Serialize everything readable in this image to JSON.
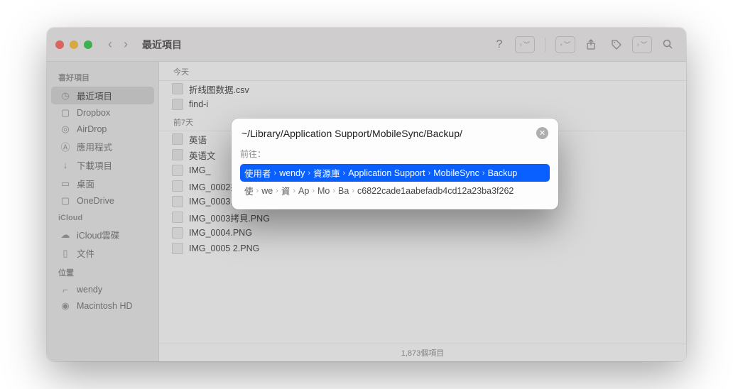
{
  "window": {
    "title": "最近項目"
  },
  "sidebar": {
    "sections": [
      {
        "header": "喜好項目",
        "items": [
          {
            "icon": "clock",
            "label": "最近項目",
            "active": true
          },
          {
            "icon": "folder",
            "label": "Dropbox"
          },
          {
            "icon": "airdrop",
            "label": "AirDrop"
          },
          {
            "icon": "apps",
            "label": "應用程式"
          },
          {
            "icon": "download",
            "label": "下載項目"
          },
          {
            "icon": "desktop",
            "label": "桌面"
          },
          {
            "icon": "folder",
            "label": "OneDrive"
          }
        ]
      },
      {
        "header": "iCloud",
        "items": [
          {
            "icon": "cloud",
            "label": "iCloud雲碟"
          },
          {
            "icon": "doc",
            "label": "文件"
          }
        ]
      },
      {
        "header": "位置",
        "items": [
          {
            "icon": "laptop",
            "label": "wendy"
          },
          {
            "icon": "disk",
            "label": "Macintosh HD"
          }
        ]
      }
    ]
  },
  "content": {
    "groups": [
      {
        "header": "今天",
        "files": [
          {
            "kind": "doc",
            "name": "折线图数据.csv"
          },
          {
            "kind": "exec",
            "name": "find-i"
          }
        ]
      },
      {
        "header": "前7天",
        "files": [
          {
            "kind": "doc",
            "name": "英语"
          },
          {
            "kind": "doc",
            "name": "英语文"
          },
          {
            "kind": "png",
            "name": "IMG_"
          },
          {
            "kind": "png",
            "name": "IMG_0002拷貝.PNG"
          },
          {
            "kind": "png",
            "name": "IMG_0003.PNG"
          },
          {
            "kind": "png",
            "name": "IMG_0003拷貝.PNG"
          },
          {
            "kind": "png",
            "name": "IMG_0004.PNG"
          },
          {
            "kind": "png",
            "name": "IMG_0005 2.PNG"
          }
        ]
      }
    ],
    "footer": "1,873個項目"
  },
  "goto": {
    "path": "~/Library/Application Support/MobileSync/Backup/",
    "label": "前往：",
    "primary": [
      "使用者",
      "wendy",
      "資源庫",
      "Application Support",
      "MobileSync",
      "Backup"
    ],
    "secondary": [
      "使",
      "we",
      "資",
      "Ap",
      "Mo",
      "Ba"
    ],
    "hash": "c6822cade1aabefadb4cd12a23ba3f262"
  }
}
